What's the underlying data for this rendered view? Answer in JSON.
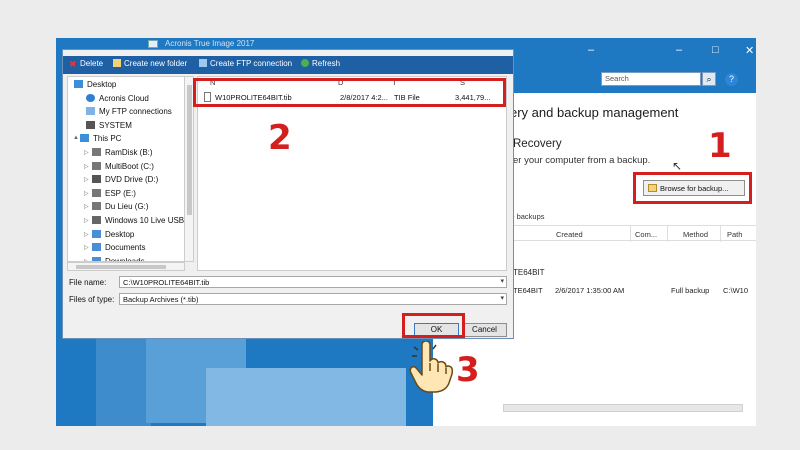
{
  "app": {
    "title": "Acronis True Image 2017",
    "search_placeholder": "Search",
    "heading": "ery and backup management",
    "recovery_title": "Recovery",
    "recovery_sub": "er your computer from a backup.",
    "browse_label": "Browse for backup...",
    "file_backups_label": "ile backups",
    "table_headers": [
      "Created",
      "Com...",
      "Method",
      "Path"
    ],
    "row_label": "TE64BIT",
    "row": {
      "name": "TE64BIT",
      "created": "2/6/2017 1:35:00 AM",
      "method": "Full backup",
      "path": "C:\\W10"
    }
  },
  "dialog": {
    "toolbar": {
      "delete": "Delete",
      "create_folder": "Create new folder",
      "create_ftp": "Create FTP connection",
      "refresh": "Refresh"
    },
    "tree": [
      {
        "label": "Desktop",
        "icon": "desktop-icon"
      },
      {
        "label": "Acronis Cloud",
        "icon": "cloud-icon"
      },
      {
        "label": "My FTP connections",
        "icon": "ftp-icon"
      },
      {
        "label": "SYSTEM",
        "icon": "user-icon"
      },
      {
        "label": "This PC",
        "icon": "computer-icon"
      },
      {
        "label": "RamDisk (B:)",
        "icon": "drive-icon"
      },
      {
        "label": "MultiBoot (C:)",
        "icon": "drive-icon"
      },
      {
        "label": "DVD Drive (D:)",
        "icon": "dvd-icon"
      },
      {
        "label": "ESP (E:)",
        "icon": "drive-icon"
      },
      {
        "label": "Du Lieu (G:)",
        "icon": "drive-icon"
      },
      {
        "label": "Windows 10 Live USB (",
        "icon": "usb-icon"
      },
      {
        "label": "Desktop",
        "icon": "folder-icon"
      },
      {
        "label": "Documents",
        "icon": "folder-icon"
      },
      {
        "label": "Downloads",
        "icon": "folder-icon"
      }
    ],
    "columns": [
      "N",
      "D",
      "T",
      "S"
    ],
    "file": {
      "name": "W10PROLITE64BIT.tib",
      "date": "2/8/2017 4:2...",
      "type": "TIB File",
      "size": "3,441,79..."
    },
    "filename_label": "File name:",
    "filename_value": "C:\\W10PROLITE64BIT.tib",
    "filetype_label": "Files of type:",
    "filetype_value": "Backup Archives (*.tib)",
    "ok_label": "OK",
    "cancel_label": "Cancel"
  },
  "annotations": {
    "step1": "1",
    "step2": "2",
    "step3": "3",
    "color": "#d3201f"
  },
  "colors": {
    "accent_blue": "#1f78c2",
    "toolbar_blue": "#1f5fa3"
  }
}
